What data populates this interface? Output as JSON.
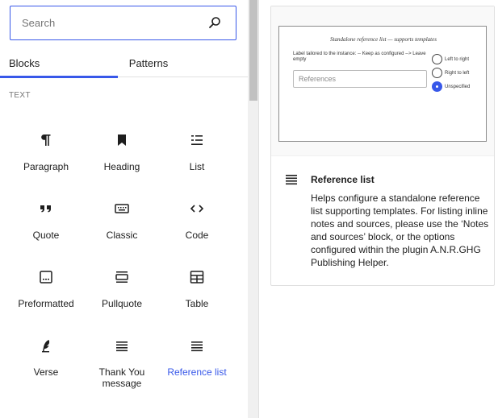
{
  "search": {
    "placeholder": "Search"
  },
  "tabs": [
    {
      "label": "Blocks",
      "active": true
    },
    {
      "label": "Patterns",
      "active": false
    }
  ],
  "section": {
    "label": "TEXT"
  },
  "blocks": [
    {
      "label": "Paragraph",
      "icon": "paragraph-icon"
    },
    {
      "label": "Heading",
      "icon": "bookmark-icon"
    },
    {
      "label": "List",
      "icon": "list-icon"
    },
    {
      "label": "Quote",
      "icon": "quote-icon"
    },
    {
      "label": "Classic",
      "icon": "keyboard-icon"
    },
    {
      "label": "Code",
      "icon": "code-icon"
    },
    {
      "label": "Preformatted",
      "icon": "preformatted-icon"
    },
    {
      "label": "Pullquote",
      "icon": "pullquote-icon"
    },
    {
      "label": "Table",
      "icon": "table-icon"
    },
    {
      "label": "Verse",
      "icon": "feather-icon"
    },
    {
      "label": "Thank You message",
      "icon": "justify-icon"
    },
    {
      "label": "Reference list",
      "icon": "justify-icon",
      "active": true
    }
  ],
  "preview": {
    "title": "Standalone reference list — supports templates",
    "hint": "Label tailored to the instance: -- Keep as configured --> Leave empty",
    "input_placeholder": "References",
    "radios": [
      {
        "label": "Left to right",
        "checked": false
      },
      {
        "label": "Right to left",
        "checked": false
      },
      {
        "label": "Unspecified",
        "checked": true
      }
    ]
  },
  "description": {
    "title": "Reference list",
    "text": "Helps configure a standalone reference list supporting templates. For listing inline notes and sources, please use the ‘Notes and sources’ block, or the options configured within the plugin A.N.R.GHG Publishing Helper."
  },
  "colors": {
    "accent": "#3858e9",
    "text": "#1e1e1e",
    "muted": "#757575"
  }
}
